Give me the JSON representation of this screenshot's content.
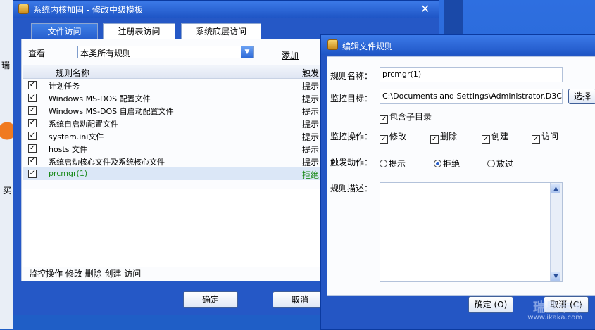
{
  "background": {
    "left_texts": [
      "瑞",
      "买"
    ]
  },
  "main_window": {
    "title": "系统内核加固 - 修改中级模板",
    "tabs": [
      "文件访问",
      "注册表访问",
      "系统底层访问"
    ],
    "view_label": "查看",
    "view_value": "本类所有规则",
    "add_link": "添加",
    "columns": [
      "规则名称",
      "触发"
    ],
    "rules": [
      {
        "name": "计划任务",
        "action": "提示",
        "checked": true,
        "selected": false
      },
      {
        "name": "Windows MS-DOS 配置文件",
        "action": "提示",
        "checked": true,
        "selected": false
      },
      {
        "name": "Windows MS-DOS 自启动配置文件",
        "action": "提示",
        "checked": true,
        "selected": false
      },
      {
        "name": "系统自启动配置文件",
        "action": "提示",
        "checked": true,
        "selected": false
      },
      {
        "name": "system.ini文件",
        "action": "提示",
        "checked": true,
        "selected": false
      },
      {
        "name": "hosts 文件",
        "action": "提示",
        "checked": true,
        "selected": false
      },
      {
        "name": "系统启动核心文件及系统核心文件",
        "action": "提示",
        "checked": true,
        "selected": false
      },
      {
        "name": "prcmgr(1)",
        "action": "拒绝",
        "checked": true,
        "selected": true
      }
    ],
    "footer_ops": "监控操作  修改 删除 创建 访问",
    "ok_label": "确定",
    "cancel_label": "取消"
  },
  "dialog": {
    "title": "编辑文件规则",
    "rule_name_label": "规则名称：",
    "rule_name_value": "prcmgr(1)",
    "target_label": "监控目标：",
    "target_value": "C:\\Documents and Settings\\Administrator.D3C",
    "browse_label": "选择",
    "include_subdirs_label": "包含子目录",
    "ops_label": "监控操作：",
    "ops": [
      "修改",
      "删除",
      "创建",
      "访问"
    ],
    "trigger_label": "触发动作：",
    "triggers": [
      {
        "label": "提示",
        "selected": false
      },
      {
        "label": "拒绝",
        "selected": true
      },
      {
        "label": "放过",
        "selected": false
      }
    ],
    "desc_label": "规则描述：",
    "ok_label": "确定 (O)",
    "cancel_label": "取消 (C)"
  },
  "watermark": {
    "text": "瑞星卡卡",
    "url": "www.ikaka.com"
  },
  "icons": {
    "close": "close-icon",
    "dropdown": "chevron-down-icon",
    "check": "checkmark-icon"
  }
}
